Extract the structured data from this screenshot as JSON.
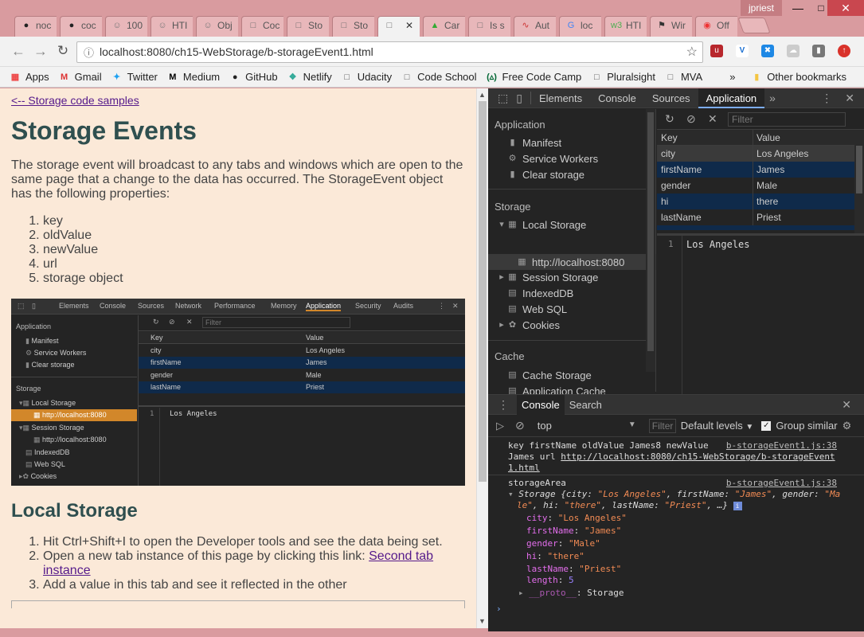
{
  "browser": {
    "user": "jpriest",
    "tabs": [
      {
        "label": "noc",
        "icon": "github-icon"
      },
      {
        "label": "coc",
        "icon": "github-icon"
      },
      {
        "label": "100",
        "icon": "person-icon"
      },
      {
        "label": "HTI",
        "icon": "person-icon"
      },
      {
        "label": "Obj",
        "icon": "person-icon"
      },
      {
        "label": "Coc",
        "icon": "page-icon"
      },
      {
        "label": "Sto",
        "icon": "page-icon"
      },
      {
        "label": "Sto",
        "icon": "page-icon"
      },
      {
        "label": "",
        "icon": "page-icon"
      },
      {
        "label": "Car",
        "icon": "chart-icon"
      },
      {
        "label": "Is s",
        "icon": "page-icon"
      },
      {
        "label": "Aut",
        "icon": "pulse-icon"
      },
      {
        "label": "loc",
        "icon": "google-icon"
      },
      {
        "label": "HTI",
        "icon": "w3-icon"
      },
      {
        "label": "Wir",
        "icon": "bird-icon"
      },
      {
        "label": "Off",
        "icon": "chrome-icon"
      }
    ],
    "url": "localhost:8080/ch15-WebStorage/b-storageEvent1.html",
    "bookmarks": [
      "Apps",
      "Gmail",
      "Twitter",
      "Medium",
      "GitHub",
      "Netlify",
      "Udacity",
      "Code School",
      "Free Code Camp",
      "Pluralsight",
      "MVA"
    ],
    "other_bookmarks": "Other bookmarks"
  },
  "page": {
    "back_link": "<-- Storage code samples",
    "title": "Storage Events",
    "intro": "The storage event will broadcast to any tabs and windows which are open to the same page that a change to the data has occurred. The StorageEvent object has the following properties:",
    "properties": [
      "key",
      "oldValue",
      "newValue",
      "url",
      "storage object"
    ],
    "section_title": "Local Storage",
    "steps": [
      "Hit Ctrl+Shift+I to open the Developer tools and see the data being set.",
      "Open a new tab instance of this page by clicking this link: ",
      "Add a value in this tab and see it reflected in the other"
    ],
    "step2_link": "Second tab instance"
  },
  "screenshot": {
    "tabs": [
      "Elements",
      "Console",
      "Sources",
      "Network",
      "Performance",
      "Memory",
      "Application",
      "Security",
      "Audits"
    ],
    "filter": "Filter",
    "side": {
      "application": "Application",
      "manifest": "Manifest",
      "service_workers": "Service Workers",
      "clear_storage": "Clear storage",
      "storage": "Storage",
      "local_storage": "Local Storage",
      "localhost": "http://localhost:8080",
      "session_storage": "Session Storage",
      "session_localhost": "http://localhost:8080",
      "indexeddb": "IndexedDB",
      "websql": "Web SQL",
      "cookies": "Cookies"
    },
    "headers": [
      "Key",
      "Value"
    ],
    "rows": [
      [
        "city",
        "Los Angeles"
      ],
      [
        "firstName",
        "James"
      ],
      [
        "gender",
        "Male"
      ],
      [
        "lastName",
        "Priest"
      ]
    ],
    "value_line": "1",
    "value": "Los Angeles"
  },
  "devtools": {
    "tabs": [
      "Elements",
      "Console",
      "Sources",
      "Application"
    ],
    "sidebar": {
      "application": "Application",
      "manifest": "Manifest",
      "service_workers": "Service Workers",
      "clear_storage": "Clear storage",
      "storage": "Storage",
      "local_storage": "Local Storage",
      "localhost": "http://localhost:8080",
      "session_storage": "Session Storage",
      "indexeddb": "IndexedDB",
      "websql": "Web SQL",
      "cookies": "Cookies",
      "cache": "Cache",
      "cache_storage": "Cache Storage",
      "application_cache": "Application Cache"
    },
    "filter_placeholder": "Filter",
    "table_headers": [
      "Key",
      "Value"
    ],
    "rows": [
      {
        "key": "city",
        "value": "Los Angeles"
      },
      {
        "key": "firstName",
        "value": "James"
      },
      {
        "key": "gender",
        "value": "Male"
      },
      {
        "key": "hi",
        "value": "there"
      },
      {
        "key": "lastName",
        "value": "Priest"
      }
    ],
    "value_line": "1",
    "value_preview": "Los Angeles",
    "drawer_tabs": [
      "Console",
      "Search"
    ],
    "context": "top",
    "console_filter": "Filter",
    "levels": "Default levels",
    "group_similar": "Group similar",
    "log1": {
      "line1": "key firstName oldValue James8 newValue",
      "line2": "James url ",
      "url1": "http://localhost:8080/ch15-WebStorage/b-storageEvent",
      "url2": "1.html",
      "source": "b-storageEvent1.js:38"
    },
    "log2": {
      "label": "storageArea",
      "source": "b-storageEvent1.js:38",
      "summary_a": "Storage {city: ",
      "summary_city": "\"Los Angeles\"",
      "summary_b": ", firstName: ",
      "summary_fn": "\"James\"",
      "summary_c": ", gender: ",
      "summary_g1": "\"Ma",
      "summary_g2": "le\"",
      "summary_d": ", hi: ",
      "summary_hi": "\"there\"",
      "summary_e": ", lastName: ",
      "summary_ln": "\"Priest\"",
      "summary_f": ", …}",
      "props": [
        {
          "k": "city",
          "v": "\"Los Angeles\""
        },
        {
          "k": "firstName",
          "v": "\"James\""
        },
        {
          "k": "gender",
          "v": "\"Male\""
        },
        {
          "k": "hi",
          "v": "\"there\""
        },
        {
          "k": "lastName",
          "v": "\"Priest\""
        }
      ],
      "length_k": "length",
      "length_v": "5",
      "proto_k": "__proto__",
      "proto_v": "Storage"
    }
  },
  "colors": {
    "titlebar": "#d99b9f",
    "page_bg": "#fbe9d8",
    "devtools_bg": "#242424",
    "accent": "#7cacf8",
    "selected_row": "#0f2a4a"
  }
}
